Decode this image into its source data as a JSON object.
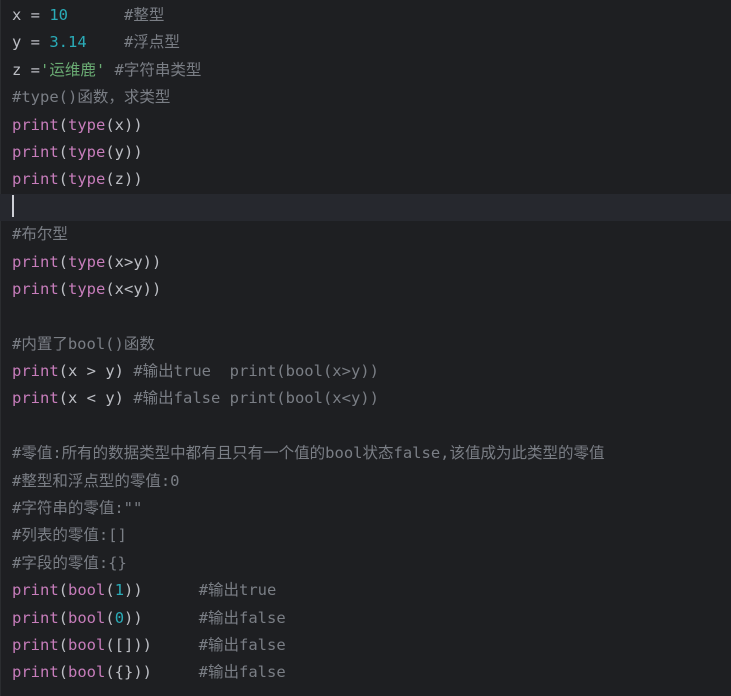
{
  "editor": {
    "language": "python",
    "caret_line": 8,
    "lines": [
      [
        {
          "t": "x = ",
          "c": "plain"
        },
        {
          "t": "10",
          "c": "num"
        },
        {
          "t": "      ",
          "c": "plain"
        },
        {
          "t": "#整型",
          "c": "cmt"
        }
      ],
      [
        {
          "t": "y = ",
          "c": "plain"
        },
        {
          "t": "3.14",
          "c": "num"
        },
        {
          "t": "    ",
          "c": "plain"
        },
        {
          "t": "#浮点型",
          "c": "cmt"
        }
      ],
      [
        {
          "t": "z =",
          "c": "plain"
        },
        {
          "t": "'运维鹿'",
          "c": "str"
        },
        {
          "t": " ",
          "c": "plain"
        },
        {
          "t": "#字符串类型",
          "c": "cmt"
        }
      ],
      [
        {
          "t": "#type()函数，求类型",
          "c": "cmt"
        }
      ],
      [
        {
          "t": "print",
          "c": "kw"
        },
        {
          "t": "(",
          "c": "plain"
        },
        {
          "t": "type",
          "c": "kw"
        },
        {
          "t": "(x))",
          "c": "plain"
        }
      ],
      [
        {
          "t": "print",
          "c": "kw"
        },
        {
          "t": "(",
          "c": "plain"
        },
        {
          "t": "type",
          "c": "kw"
        },
        {
          "t": "(y))",
          "c": "plain"
        }
      ],
      [
        {
          "t": "print",
          "c": "kw"
        },
        {
          "t": "(",
          "c": "plain"
        },
        {
          "t": "type",
          "c": "kw"
        },
        {
          "t": "(z))",
          "c": "plain"
        }
      ],
      [],
      [
        {
          "t": "#布尔型",
          "c": "cmt"
        }
      ],
      [
        {
          "t": "print",
          "c": "kw"
        },
        {
          "t": "(",
          "c": "plain"
        },
        {
          "t": "type",
          "c": "kw"
        },
        {
          "t": "(x>y))",
          "c": "plain"
        }
      ],
      [
        {
          "t": "print",
          "c": "kw"
        },
        {
          "t": "(",
          "c": "plain"
        },
        {
          "t": "type",
          "c": "kw"
        },
        {
          "t": "(x<y))",
          "c": "plain"
        }
      ],
      [],
      [
        {
          "t": "#内置了bool()函数",
          "c": "cmt"
        }
      ],
      [
        {
          "t": "print",
          "c": "kw"
        },
        {
          "t": "(x > y) ",
          "c": "plain"
        },
        {
          "t": "#输出true  print(bool(x>y))",
          "c": "cmt"
        }
      ],
      [
        {
          "t": "print",
          "c": "kw"
        },
        {
          "t": "(x < y) ",
          "c": "plain"
        },
        {
          "t": "#输出false print(bool(x<y))",
          "c": "cmt"
        }
      ],
      [],
      [
        {
          "t": "#零值:所有的数据类型中都有且只有一个值的bool状态false,该值成为此类型的零值",
          "c": "cmt"
        }
      ],
      [
        {
          "t": "#整型和浮点型的零值:0",
          "c": "cmt"
        }
      ],
      [
        {
          "t": "#字符串的零值:\"\"",
          "c": "cmt"
        }
      ],
      [
        {
          "t": "#列表的零值:[]",
          "c": "cmt"
        }
      ],
      [
        {
          "t": "#字段的零值:{}",
          "c": "cmt"
        }
      ],
      [
        {
          "t": "print",
          "c": "kw"
        },
        {
          "t": "(",
          "c": "plain"
        },
        {
          "t": "bool",
          "c": "kw"
        },
        {
          "t": "(",
          "c": "plain"
        },
        {
          "t": "1",
          "c": "num"
        },
        {
          "t": "))      ",
          "c": "plain"
        },
        {
          "t": "#输出true",
          "c": "cmt"
        }
      ],
      [
        {
          "t": "print",
          "c": "kw"
        },
        {
          "t": "(",
          "c": "plain"
        },
        {
          "t": "bool",
          "c": "kw"
        },
        {
          "t": "(",
          "c": "plain"
        },
        {
          "t": "0",
          "c": "num"
        },
        {
          "t": "))      ",
          "c": "plain"
        },
        {
          "t": "#输出false",
          "c": "cmt"
        }
      ],
      [
        {
          "t": "print",
          "c": "kw"
        },
        {
          "t": "(",
          "c": "plain"
        },
        {
          "t": "bool",
          "c": "kw"
        },
        {
          "t": "([]))     ",
          "c": "plain"
        },
        {
          "t": "#输出false",
          "c": "cmt"
        }
      ],
      [
        {
          "t": "print",
          "c": "kw"
        },
        {
          "t": "(",
          "c": "plain"
        },
        {
          "t": "bool",
          "c": "kw"
        },
        {
          "t": "({}))     ",
          "c": "plain"
        },
        {
          "t": "#输出false",
          "c": "cmt"
        }
      ]
    ]
  },
  "colors": {
    "background": "#1e1f22",
    "current_line": "#26282e",
    "keyword": "#c77dbb",
    "number": "#2aacb8",
    "string": "#6aab73",
    "comment": "#7a7e85",
    "text": "#bcbec4"
  }
}
